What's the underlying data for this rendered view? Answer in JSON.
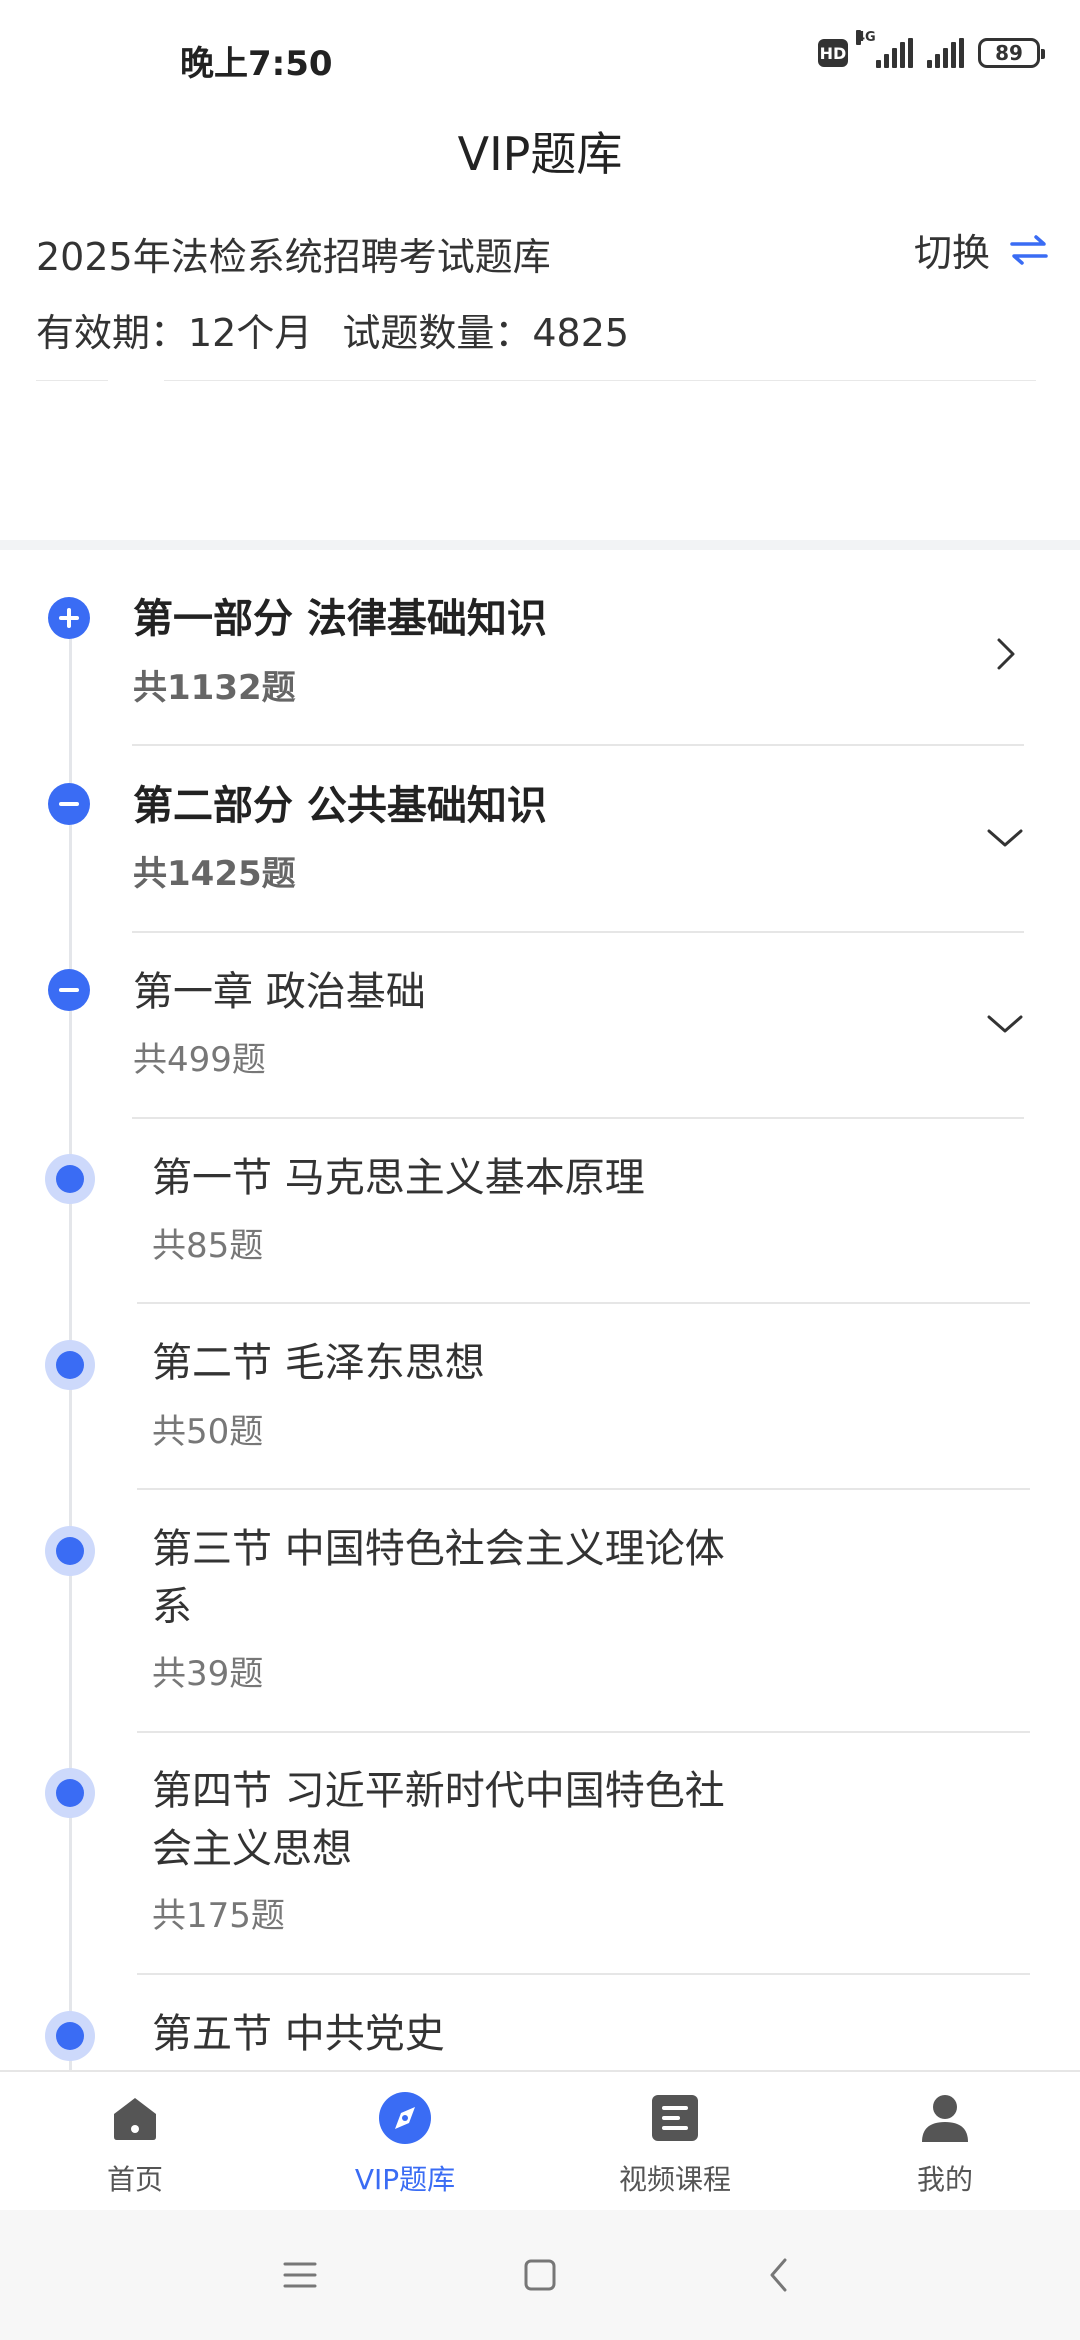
{
  "status_bar": {
    "time": "晚上7:50",
    "hd": "HD",
    "network": "4G",
    "battery": "89"
  },
  "header": {
    "title": "VIP题库"
  },
  "bank": {
    "name": "2025年法检系统招聘考试题库",
    "switch_label": "切换",
    "validity": "有效期：12个月",
    "question_count": "试题数量：4825"
  },
  "tree": [
    {
      "title": "第一部分 法律基础知识",
      "count": "共1132题",
      "level": "part",
      "state": "collapsed"
    },
    {
      "title": "第二部分 公共基础知识",
      "count": "共1425题",
      "level": "part",
      "state": "expanded"
    },
    {
      "title": "第一章 政治基础",
      "count": "共499题",
      "level": "chapter",
      "state": "expanded"
    },
    {
      "title_lines": [
        "第一节 马克思主义基本原理"
      ],
      "count": "共85题",
      "level": "section"
    },
    {
      "title_lines": [
        "第二节 毛泽东思想"
      ],
      "count": "共50题",
      "level": "section"
    },
    {
      "title_lines": [
        "第三节 中国特色社会主义理论体",
        "系"
      ],
      "count": "共39题",
      "level": "section"
    },
    {
      "title_lines": [
        "第四节 习近平新时代中国特色社",
        "会主义思想"
      ],
      "count": "共175题",
      "level": "section"
    },
    {
      "title_lines": [
        "第五节 中共党史"
      ],
      "count": "",
      "level": "section"
    }
  ],
  "bottom_nav": [
    {
      "label": "首页",
      "icon": "home-icon"
    },
    {
      "label": "VIP题库",
      "icon": "compass-icon",
      "active": true
    },
    {
      "label": "视频课程",
      "icon": "document-icon"
    },
    {
      "label": "我的",
      "icon": "person-icon"
    }
  ],
  "colors": {
    "accent": "#3a6cf4",
    "node_halo": "#cdd9fb",
    "divider": "#e6e6e6"
  }
}
